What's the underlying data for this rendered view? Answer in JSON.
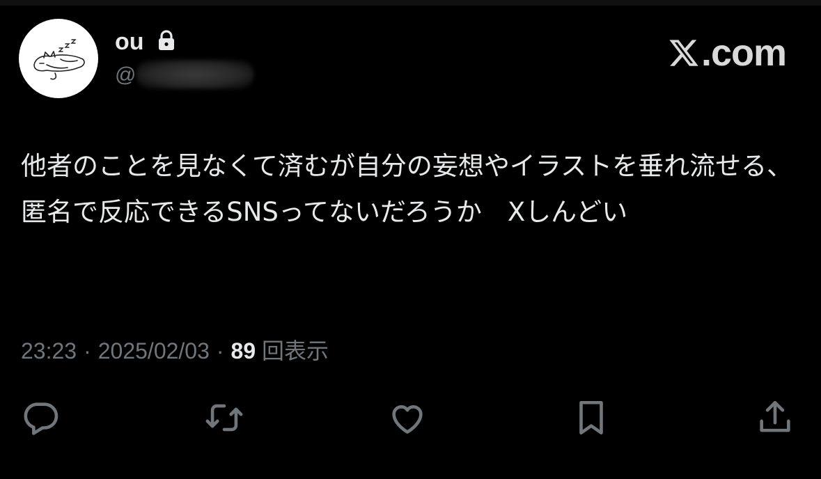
{
  "author": {
    "display_name": "ou",
    "handle_prefix": "@",
    "avatar_icon": "sleeping-cat-avatar",
    "protected_icon": "lock-icon"
  },
  "brand": {
    "logo_text": ".com",
    "logo_icon": "x-logo-icon"
  },
  "tweet": {
    "text": "他者のことを見なくて済むが自分の妄想やイラストを垂れ流せる、匿名で反応できるSNSってないだろうか　Xしんどい"
  },
  "meta": {
    "time": "23:23",
    "separator": "·",
    "date": "2025/02/03",
    "views_count": "89",
    "views_label": "回表示"
  },
  "actions": [
    {
      "name": "reply",
      "icon": "reply-icon"
    },
    {
      "name": "retweet",
      "icon": "retweet-icon"
    },
    {
      "name": "like",
      "icon": "heart-icon"
    },
    {
      "name": "bookmark",
      "icon": "bookmark-icon"
    },
    {
      "name": "share",
      "icon": "share-icon"
    }
  ],
  "colors": {
    "background": "#000000",
    "primary_text": "#e7e9ea",
    "secondary_text": "#71767b",
    "icon_stroke": "#71767b"
  }
}
